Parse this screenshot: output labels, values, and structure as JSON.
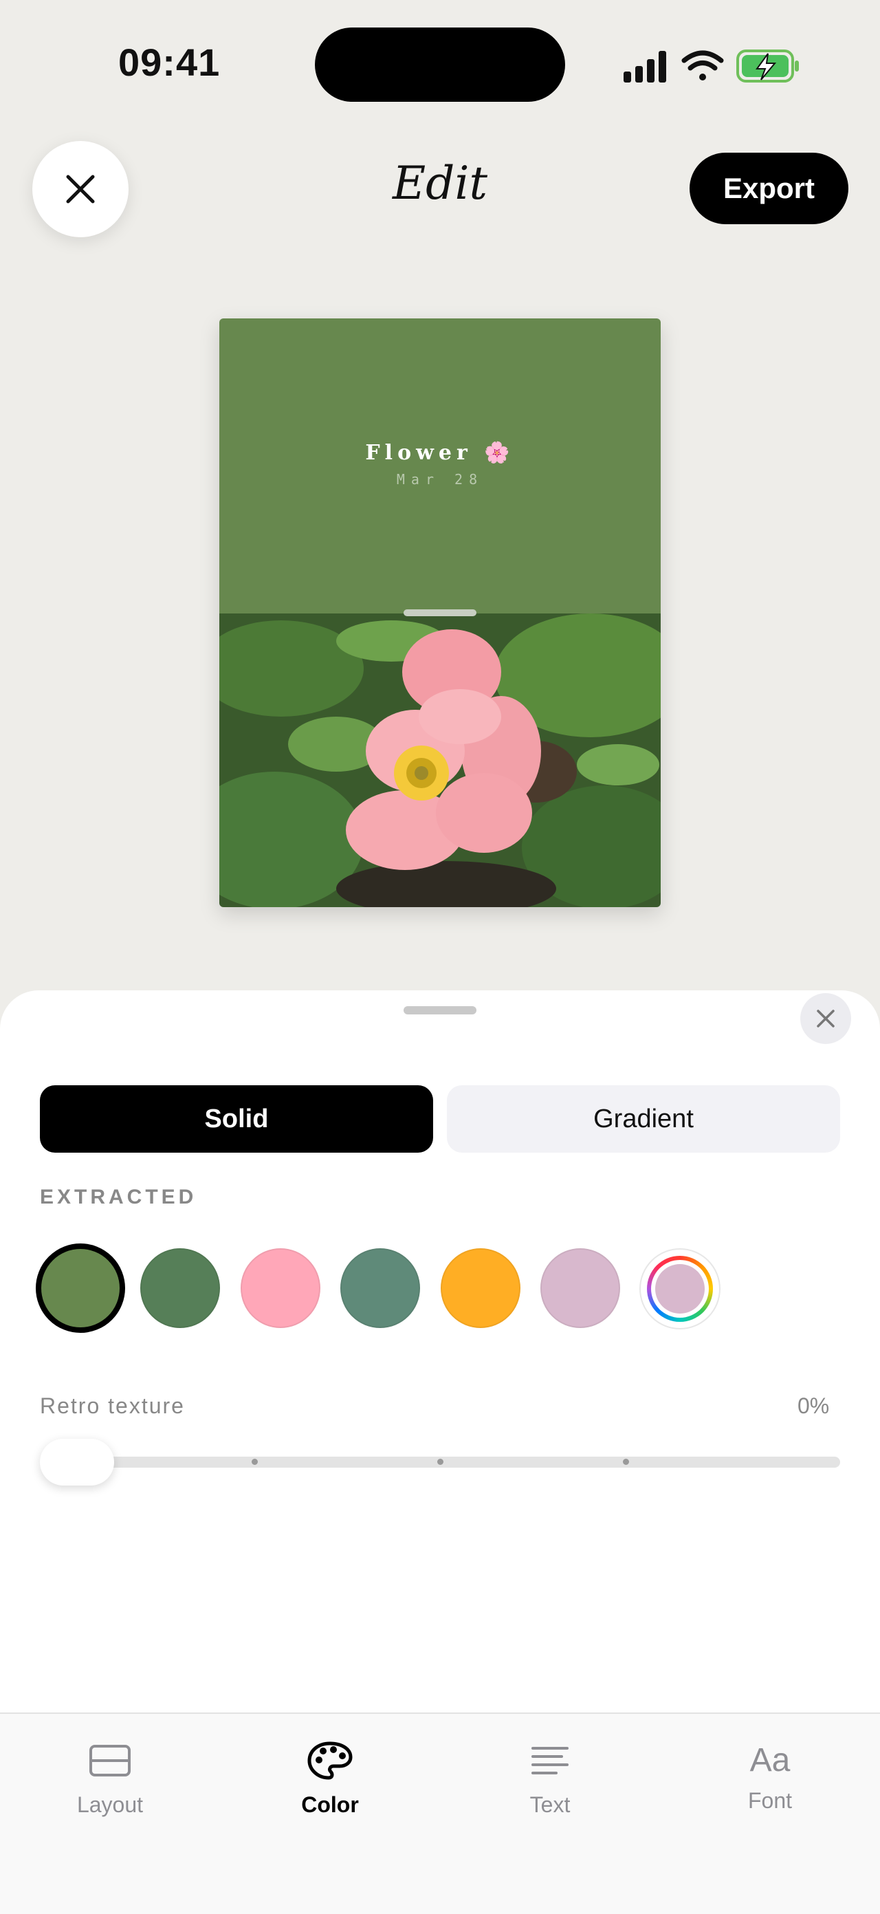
{
  "status_bar": {
    "time": "09:41"
  },
  "header": {
    "title": "Edit",
    "export_label": "Export"
  },
  "card": {
    "title": "Flower",
    "emoji": "🌸",
    "date": "Mar 28",
    "background_color": "#67884e"
  },
  "segmented": {
    "options": [
      "Solid",
      "Gradient"
    ],
    "selected": "Solid"
  },
  "extracted": {
    "label": "EXTRACTED",
    "swatches": [
      "#67884e",
      "#567f58",
      "#ffa7b8",
      "#5f8a79",
      "#ffae24",
      "#d8b8cd"
    ],
    "selected_index": 0,
    "picker_color": "#d8b8cd"
  },
  "slider": {
    "label": "Retro texture",
    "value": "0%"
  },
  "tabs": [
    {
      "label": "Layout",
      "icon": "layout-icon"
    },
    {
      "label": "Color",
      "icon": "palette-icon"
    },
    {
      "label": "Text",
      "icon": "text-lines-icon"
    },
    {
      "label": "Font",
      "icon": "font-aa-icon",
      "glyph": "Aa"
    }
  ],
  "active_tab": "Color",
  "colors": {
    "background": "#eeede9",
    "accent": "#000000"
  }
}
